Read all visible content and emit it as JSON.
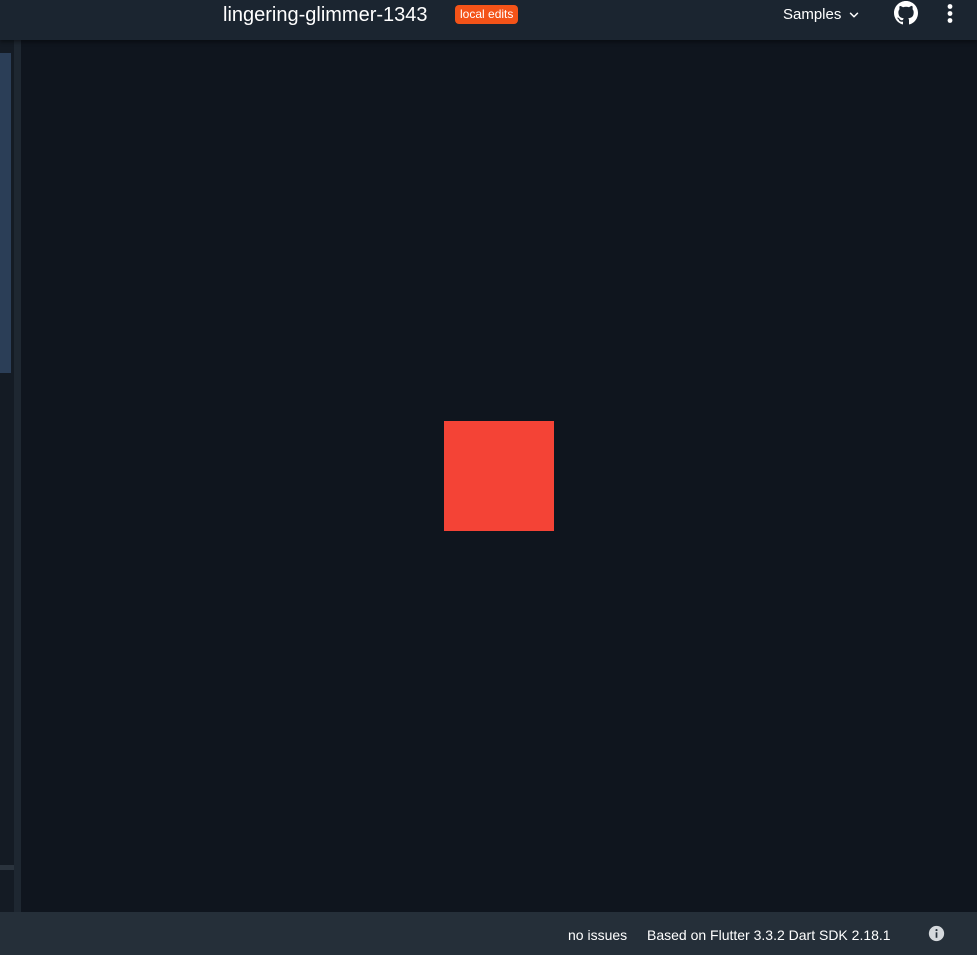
{
  "header": {
    "title": "lingering-glimmer-1343",
    "badge": "local edits",
    "samples_label": "Samples",
    "icons": {
      "samples_dropdown": "chevron-down-icon",
      "github": "github-icon",
      "more": "more-vert-icon"
    }
  },
  "output": {
    "box_color": "#f44336"
  },
  "status": {
    "issues": "no issues",
    "version": "Based on Flutter 3.3.2 Dart SDK 2.18.1",
    "icon": "info-icon"
  },
  "colors": {
    "background": "#0f151e",
    "header_bg": "#1b2530",
    "status_bg": "#252f39",
    "badge_bg": "#f45318",
    "accent_scroll": "#2b3e57"
  }
}
